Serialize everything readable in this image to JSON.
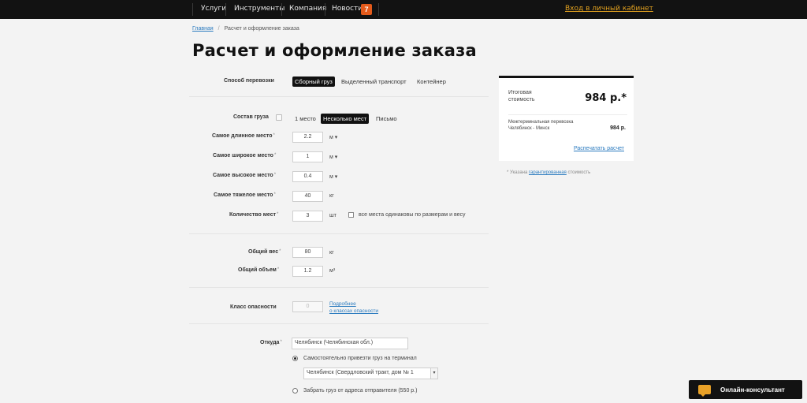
{
  "nav": {
    "items": [
      "Услуги",
      "Инструменты",
      "Компания",
      "Новости"
    ],
    "news_count": "7",
    "cabinet_link": "Вход в личный кабинет"
  },
  "breadcrumb": {
    "home": "Главная",
    "sep": "/",
    "current": "Расчет и оформление заказа"
  },
  "title": "Расчет и оформление заказа",
  "transport": {
    "label": "Способ перевозки",
    "options": [
      "Сборный груз",
      "Выделенный транспорт",
      "Контейнер"
    ],
    "selected": "Сборный груз"
  },
  "cargo": {
    "label": "Состав груза",
    "options": [
      "1 место",
      "Несколько мест",
      "Письмо"
    ],
    "selected": "Несколько мест"
  },
  "fields": {
    "longest": {
      "label": "Самое длинное место",
      "value": "2.2",
      "unit": "м"
    },
    "widest": {
      "label": "Самое широкое место",
      "value": "1",
      "unit": "м"
    },
    "highest": {
      "label": "Самое высокое место",
      "value": "0.4",
      "unit": "м"
    },
    "heaviest": {
      "label": "Самое тяжелое место",
      "value": "40",
      "unit": "кг"
    },
    "count": {
      "label": "Количество мест",
      "value": "3",
      "unit": "шт",
      "checkbox_label": "все места одинаковы по размерам и весу"
    },
    "total_weight": {
      "label": "Общий вес",
      "value": "80",
      "unit": "кг"
    },
    "total_volume": {
      "label": "Общий объем",
      "value": "1.2",
      "unit": "м³"
    },
    "hazard": {
      "label": "Класс опасности",
      "value": "0",
      "link_line1": "Подробнее",
      "link_line2": "о классах опасности"
    }
  },
  "from": {
    "label": "Откуда",
    "value": "Челябинск (Челябинская обл.)",
    "option_terminal": "Самостоятельно привезти груз на терминал",
    "terminal_value": "Челябинск (Свердловский тракт, дом № 1",
    "option_pickup": "Забрать груз от адреса отправителя (550 р.)"
  },
  "summary": {
    "total_label_line1": "Итоговая",
    "total_label_line2": "стоимость",
    "total_value": "984 р.*",
    "route_title": "Межтерминальная перевозка",
    "route": "Челябинск - Минск",
    "route_price": "984 р.",
    "print_link": "Распечатать расчет",
    "footnote_prefix": "* Указана",
    "footnote_link": "гарантированная",
    "footnote_suffix": "стоимость"
  },
  "consultant": {
    "label": "Онлайн-консультант"
  }
}
